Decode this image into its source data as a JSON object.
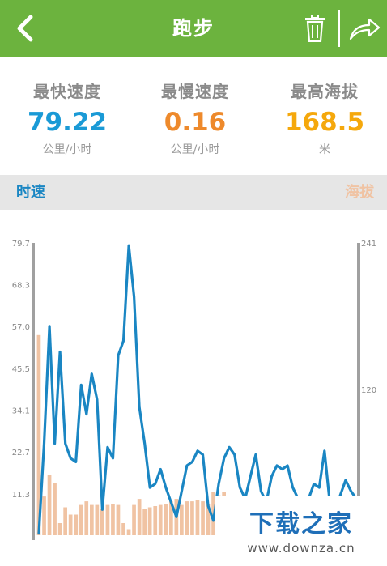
{
  "header": {
    "title": "跑步",
    "back_icon": "chevron-left-icon",
    "trash_icon": "trash-icon",
    "share_icon": "share-arrow-icon"
  },
  "stats": [
    {
      "label": "最快速度",
      "value": "79.22",
      "unit": "公里/小时",
      "color": "#1a9ad6"
    },
    {
      "label": "最慢速度",
      "value": "0.16",
      "unit": "公里/小时",
      "color": "#ee8a2c"
    },
    {
      "label": "最高海拔",
      "value": "168.5",
      "unit": "米",
      "color": "#f5a80c"
    }
  ],
  "legend": {
    "speed_label": "时速",
    "altitude_label": "海拔"
  },
  "colors": {
    "header_bg": "#6cb33e",
    "speed_line": "#1a86c3",
    "altitude_bar": "#f0c3a3",
    "axis": "#a0a0a0"
  },
  "watermark": {
    "main": "下载之家",
    "sub": "www.downza.cn"
  },
  "chart_data": {
    "type": "line",
    "y_left": {
      "ticks": [
        "79.7",
        "68.3",
        "57.0",
        "45.5",
        "34.1",
        "22.7",
        "11.3"
      ],
      "range": [
        0,
        79.7
      ]
    },
    "y_right": {
      "ticks": [
        "241",
        "120"
      ],
      "range": [
        0,
        241
      ]
    },
    "grid": false,
    "series": [
      {
        "name": "时速",
        "kind": "line",
        "axis": "left",
        "color": "#1a86c3",
        "values": [
          0.5,
          25,
          57,
          25,
          50,
          25,
          21,
          20,
          41,
          33,
          44,
          37,
          7,
          24,
          21,
          49,
          53,
          79,
          65,
          35,
          25,
          13,
          14,
          18,
          13,
          9,
          5,
          12,
          19,
          20,
          23,
          22,
          8,
          4,
          14,
          21,
          24,
          22,
          13,
          10,
          16,
          22,
          12,
          9,
          16,
          19,
          18,
          19,
          13,
          10,
          8,
          10,
          14,
          13,
          23,
          9,
          7,
          11,
          15,
          12,
          10
        ]
      },
      {
        "name": "海拔",
        "kind": "bar",
        "axis": "right",
        "color": "#f0c3a3",
        "values": [
          165,
          32,
          50,
          43,
          10,
          23,
          17,
          17,
          25,
          28,
          25,
          25,
          22,
          25,
          26,
          25,
          10,
          5,
          25,
          30,
          22,
          23,
          24,
          25,
          26,
          28,
          30,
          25,
          28,
          28,
          29,
          28,
          26,
          36,
          33,
          36,
          24,
          22,
          20,
          20,
          22,
          20,
          18,
          16,
          18,
          20,
          22,
          20,
          18,
          16,
          14,
          16,
          18,
          20,
          22,
          20,
          18,
          16,
          18,
          20,
          18
        ]
      }
    ]
  }
}
